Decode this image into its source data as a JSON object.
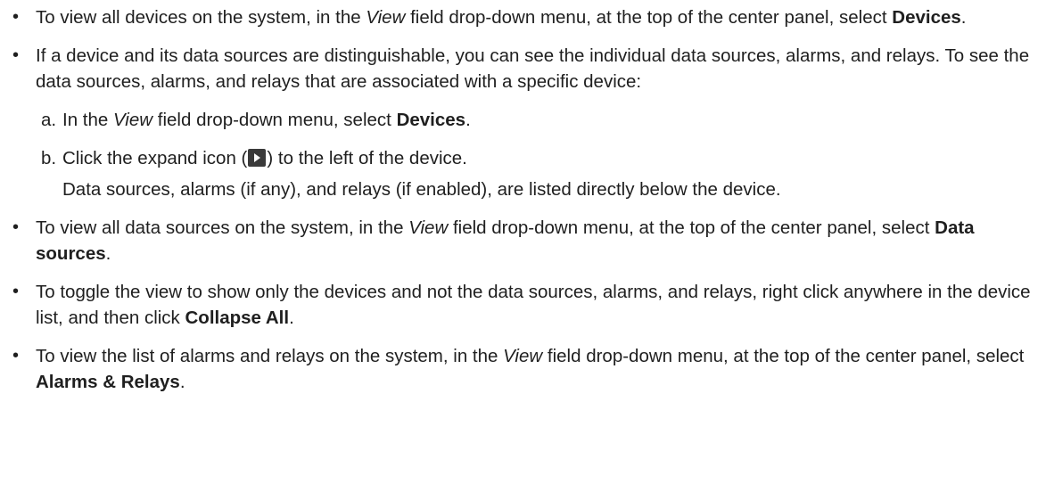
{
  "bullet_glyph": "•",
  "items": [
    {
      "a": "To view all devices on the system, in the ",
      "view": "View",
      "b": " field drop-down menu, at the top of the center panel, select ",
      "bold": "Devices",
      "end": "."
    },
    {
      "text": "If a device and its data sources are distinguishable, you can see the individual data sources, alarms, and relays. To see the data sources, alarms, and relays that are associated with a specific device:",
      "steps": [
        {
          "letter": "a.",
          "a": "In the ",
          "view": "View",
          "b": " field drop-down menu, select ",
          "bold": "Devices",
          "end": "."
        },
        {
          "letter": "b.",
          "a": "Click the expand icon (",
          "icon": "expand-icon",
          "b": ") to the left of the device.",
          "note": "Data sources, alarms (if any), and relays (if enabled), are listed directly below the device."
        }
      ]
    },
    {
      "a": "To view all data sources on the system, in the ",
      "view": "View",
      "b": " field drop-down menu, at the top of the center panel, select ",
      "bold": "Data sources",
      "end": "."
    },
    {
      "a": "To toggle the view to show only the devices and not the data sources, alarms, and relays, right click anywhere in the device list, and then click ",
      "bold": "Collapse All",
      "end": "."
    },
    {
      "a": "To view the list of alarms and relays on the system, in the ",
      "view": "View",
      "b": " field drop-down menu, at the top of the center panel, select ",
      "bold": "Alarms & Relays",
      "end": "."
    }
  ]
}
